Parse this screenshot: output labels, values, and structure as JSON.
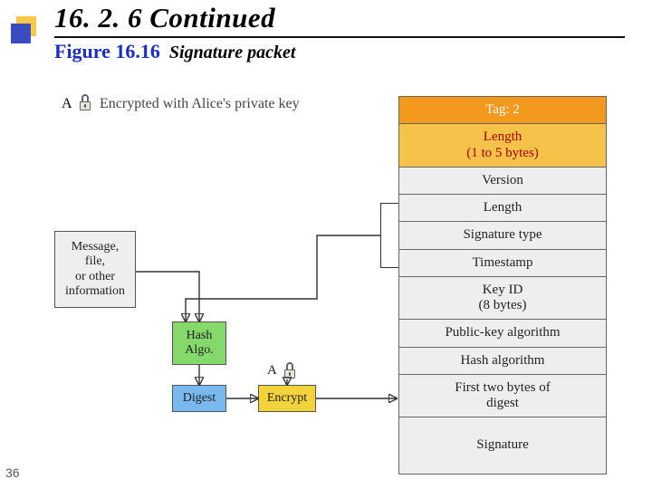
{
  "slide": {
    "heading": "16. 2. 6  Continued",
    "figure_label": "Figure 16.16",
    "figure_title": "Signature packet",
    "number": "36"
  },
  "legend": {
    "label_a": "A",
    "padlock_name": "padlock-icon",
    "encrypted_caption": "Encrypted with Alice's private key"
  },
  "left_boxes": {
    "message": "Message,\nfile,\nor other\ninformation",
    "hash": "Hash\nAlgo.",
    "digest": "Digest",
    "encrypt": "Encrypt",
    "encrypt_label_a": "A"
  },
  "packet_rows": [
    {
      "key": "tag",
      "text": "Tag: 2",
      "class": "tag"
    },
    {
      "key": "length1",
      "text": "Length\n(1 to 5 bytes)",
      "class": "len"
    },
    {
      "key": "version",
      "text": "Version",
      "class": ""
    },
    {
      "key": "length2",
      "text": "Length",
      "class": ""
    },
    {
      "key": "sigtype",
      "text": "Signature type",
      "class": ""
    },
    {
      "key": "timestamp",
      "text": "Timestamp",
      "class": ""
    },
    {
      "key": "keyid",
      "text": "Key ID\n(8 bytes)",
      "class": ""
    },
    {
      "key": "pubalgo",
      "text": "Public-key algorithm",
      "class": ""
    },
    {
      "key": "hashalgo",
      "text": "Hash algorithm",
      "class": ""
    },
    {
      "key": "first2",
      "text": "First two bytes of\ndigest",
      "class": ""
    },
    {
      "key": "signature",
      "text": "Signature",
      "class": "sig"
    }
  ]
}
